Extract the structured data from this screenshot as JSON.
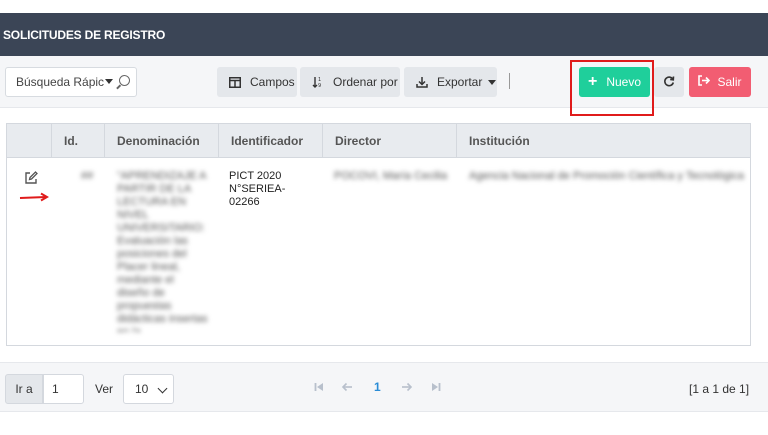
{
  "header": {
    "title": "SOLICITUDES DE REGISTRO"
  },
  "toolbar": {
    "search_placeholder": "Búsqueda Rápic",
    "campos_label": "Campos",
    "ordenar_label": "Ordenar por",
    "exportar_label": "Exportar",
    "nuevo_label": "Nuevo",
    "salir_label": "Salir"
  },
  "table": {
    "columns": [
      "Id.",
      "Denominación",
      "Identificador",
      "Director",
      "Institución"
    ],
    "rows": [
      {
        "id": "##",
        "denominacion": "\"APRENDIZAJE A PARTIR DE LA LECTURA EN NIVEL UNIVERSITARIO: Evaluación las posiciones del Placer lineal, mediante el diseño de propuestas didácticas insertas en la investigación.\"",
        "identificador_line1": "PICT 2020",
        "identificador_line2": "N°SERIEA-",
        "identificador_line3": "02266",
        "director": "POCOVI, María Cecilia",
        "institucion": "Agencia Nacional de Promoción Científica y Tecnológica"
      }
    ]
  },
  "pagination": {
    "ir_a_label": "Ir a",
    "ir_a_value": "1",
    "ver_label": "Ver",
    "ver_value": "10",
    "current_page": "1",
    "range_text": "[1 a 1 de 1]"
  },
  "colors": {
    "header_bg": "#3b4556",
    "nuevo": "#1fcf9b",
    "salir": "#f25d72",
    "highlight": "#e01b1b",
    "page_active": "#2a8cd6"
  }
}
